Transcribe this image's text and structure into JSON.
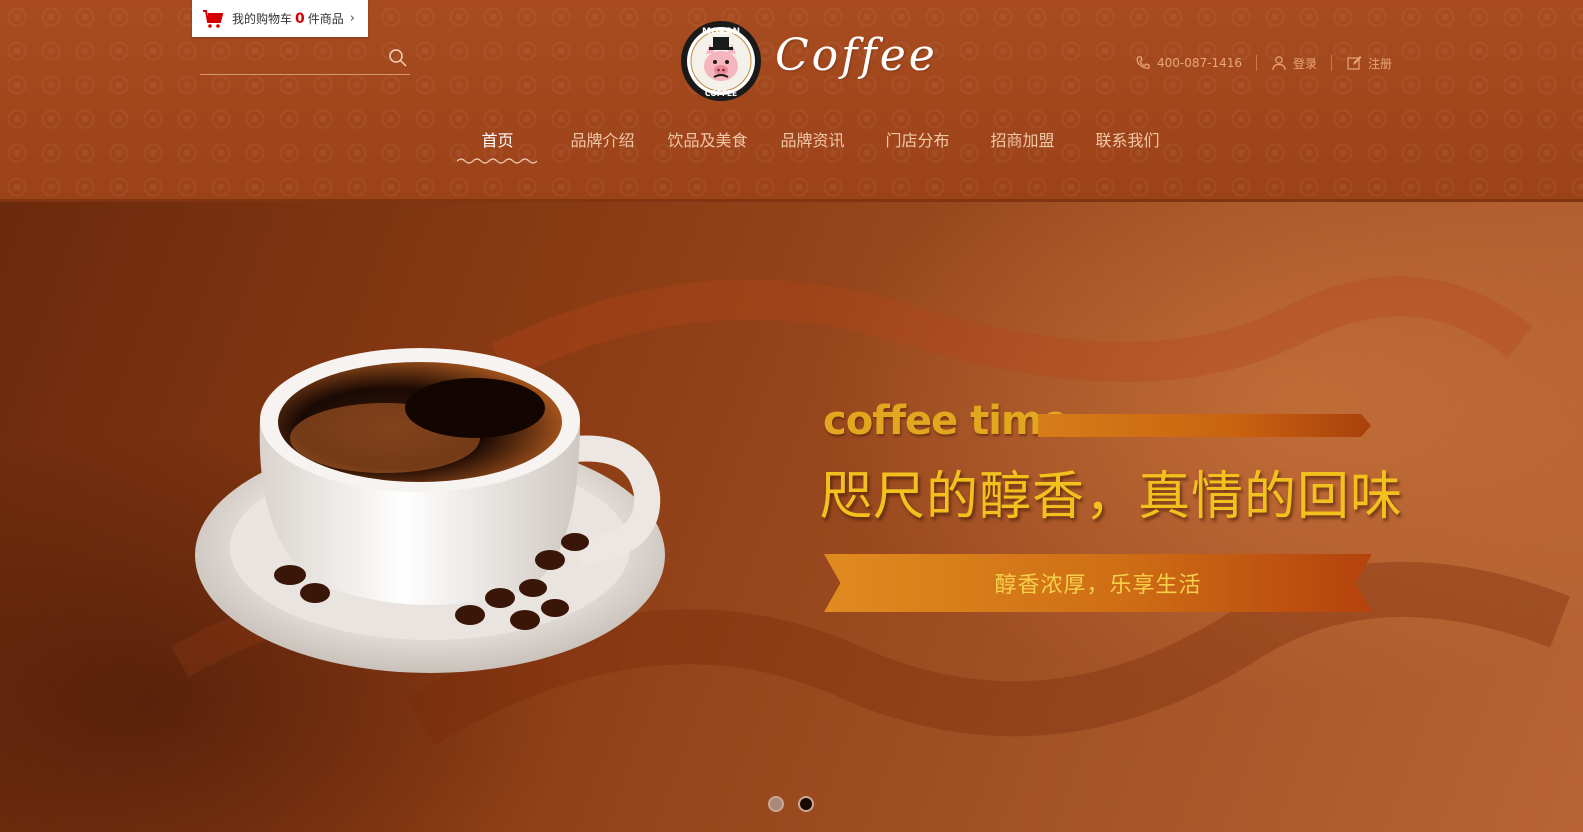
{
  "cart": {
    "prefix": "我的购物车",
    "count": "0",
    "suffix": "件商品",
    "chevron": "›"
  },
  "search": {
    "placeholder": "",
    "icon": "search-icon"
  },
  "logo": {
    "badge_top": "MORAN",
    "badge_bottom": "COFFEE",
    "wordmark": "Coffee"
  },
  "contact": {
    "phone": "400-087-1416",
    "login": "登录",
    "register": "注册"
  },
  "nav": {
    "items": [
      {
        "label": "首页",
        "active": true
      },
      {
        "label": "品牌介绍",
        "active": false
      },
      {
        "label": "饮品及美食",
        "active": false
      },
      {
        "label": "品牌资讯",
        "active": false
      },
      {
        "label": "门店分布",
        "active": false
      },
      {
        "label": "招商加盟",
        "active": false
      },
      {
        "label": "联系我们",
        "active": false
      }
    ]
  },
  "banner": {
    "tagline_en": "coffee time",
    "headline": "咫尺的醇香，真情的回味",
    "ribbon": "醇香浓厚，乐享生活",
    "slides": [
      {
        "active": false
      },
      {
        "active": true
      }
    ]
  },
  "colors": {
    "header_bg": "#a5481d",
    "accent_gold": "#f3c11d",
    "cart_count": "#d40000"
  }
}
